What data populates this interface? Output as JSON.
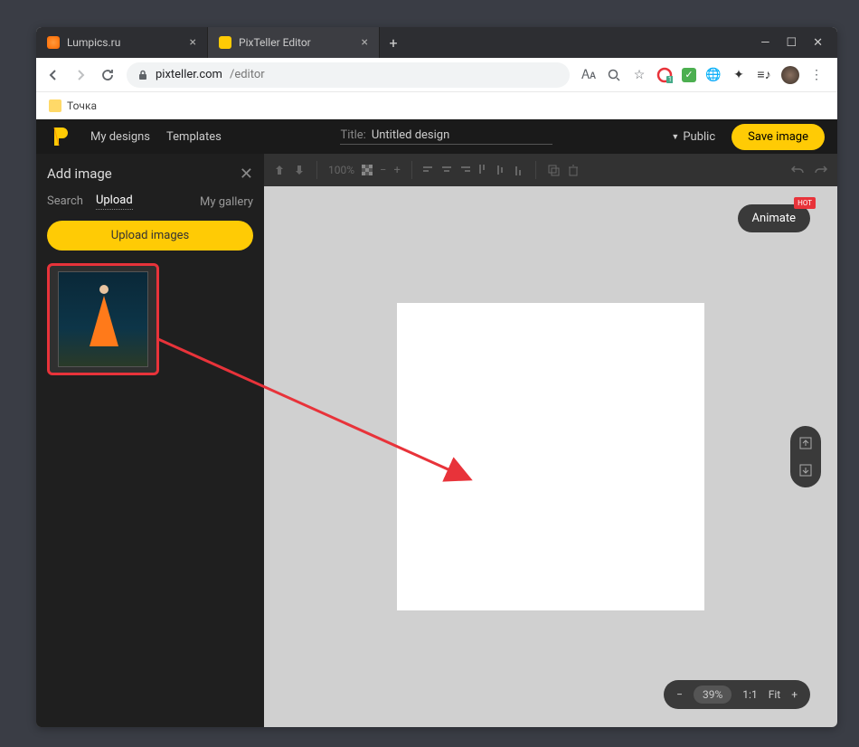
{
  "browser": {
    "tabs": [
      {
        "title": "Lumpics.ru",
        "active": false
      },
      {
        "title": "PixTeller Editor",
        "active": true
      }
    ],
    "url_host": "pixteller.com",
    "url_path": "/editor",
    "bookmark": "Точка"
  },
  "header": {
    "nav_my_designs": "My designs",
    "nav_templates": "Templates",
    "title_label": "Title:",
    "title_value": "Untitled design",
    "visibility": "Public",
    "save": "Save image"
  },
  "sidebar": {
    "panel_title": "Add image",
    "tab_search": "Search",
    "tab_upload": "Upload",
    "my_gallery": "My gallery",
    "upload_btn": "Upload images"
  },
  "toolbar": {
    "zoom_text": "100%"
  },
  "canvas": {
    "animate": "Animate",
    "hot": "HOT"
  },
  "zoom": {
    "percent": "39%",
    "ratio": "1:1",
    "fit": "Fit"
  }
}
